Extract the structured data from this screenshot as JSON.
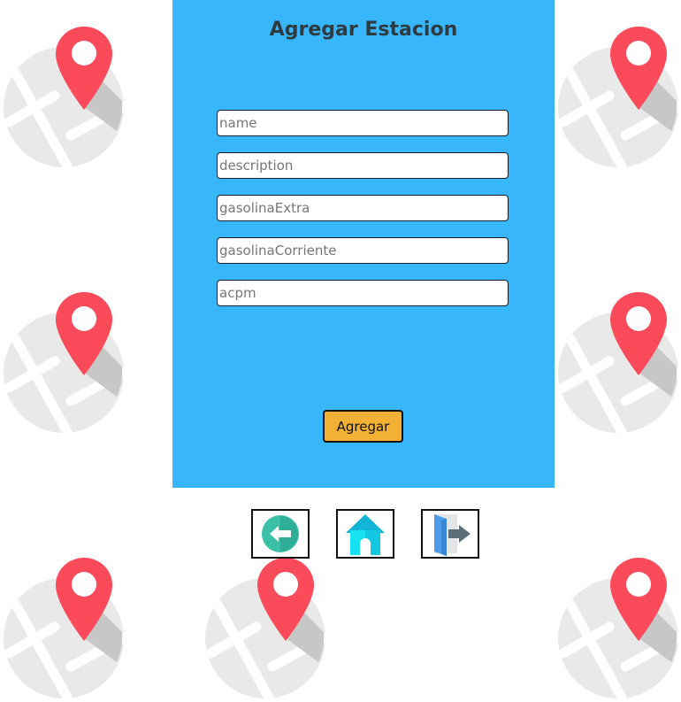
{
  "form": {
    "title": "Agregar Estacion",
    "fields": [
      {
        "name": "name",
        "placeholder": "name",
        "value": ""
      },
      {
        "name": "description",
        "placeholder": "description",
        "value": ""
      },
      {
        "name": "gasolinaExtra",
        "placeholder": "gasolinaExtra",
        "value": ""
      },
      {
        "name": "gasolinaCorriente",
        "placeholder": "gasolinaCorriente",
        "value": ""
      },
      {
        "name": "acpm",
        "placeholder": "acpm",
        "value": ""
      }
    ],
    "submit_label": "Agregar"
  },
  "nav": {
    "buttons": [
      {
        "icon": "back-arrow-icon"
      },
      {
        "icon": "home-icon"
      },
      {
        "icon": "logout-door-icon"
      }
    ]
  },
  "background": {
    "icon": "map-pin-icon"
  },
  "colors": {
    "panel": "#38b6fb",
    "title": "#2e3b40",
    "submit": "#f2b134",
    "pin": "#fb4b5a",
    "map": "#e9e9e9"
  }
}
